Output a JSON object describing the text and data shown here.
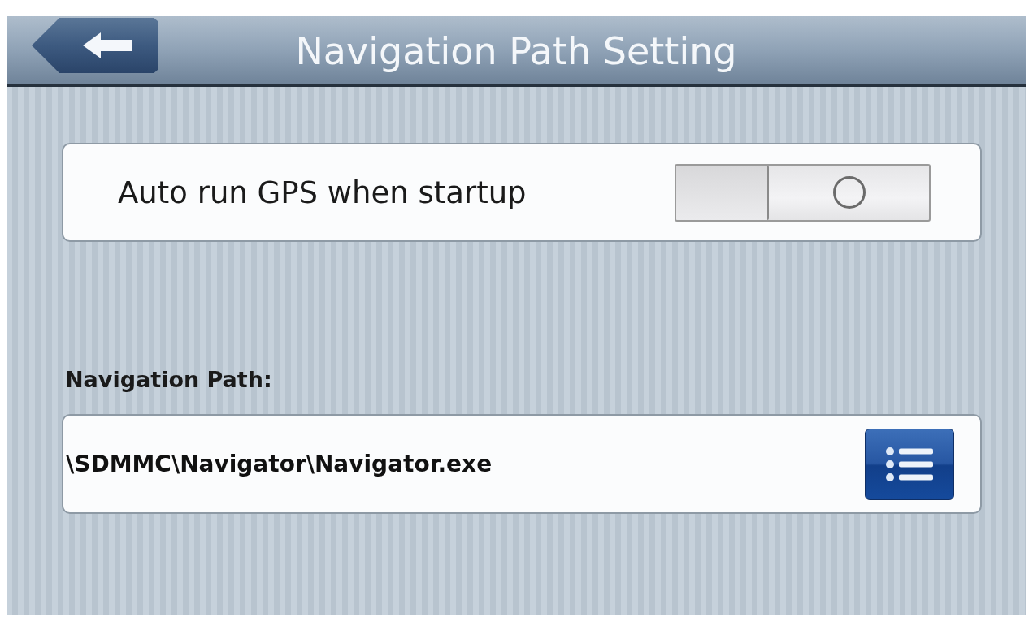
{
  "header": {
    "title": "Navigation Path Setting"
  },
  "settings": [
    {
      "kind": "toggle",
      "label": "Auto run GPS when startup",
      "on": false
    }
  ],
  "navigation_path": {
    "label": "Navigation Path:",
    "value": "\\SDMMC\\Navigator\\Navigator.exe"
  }
}
